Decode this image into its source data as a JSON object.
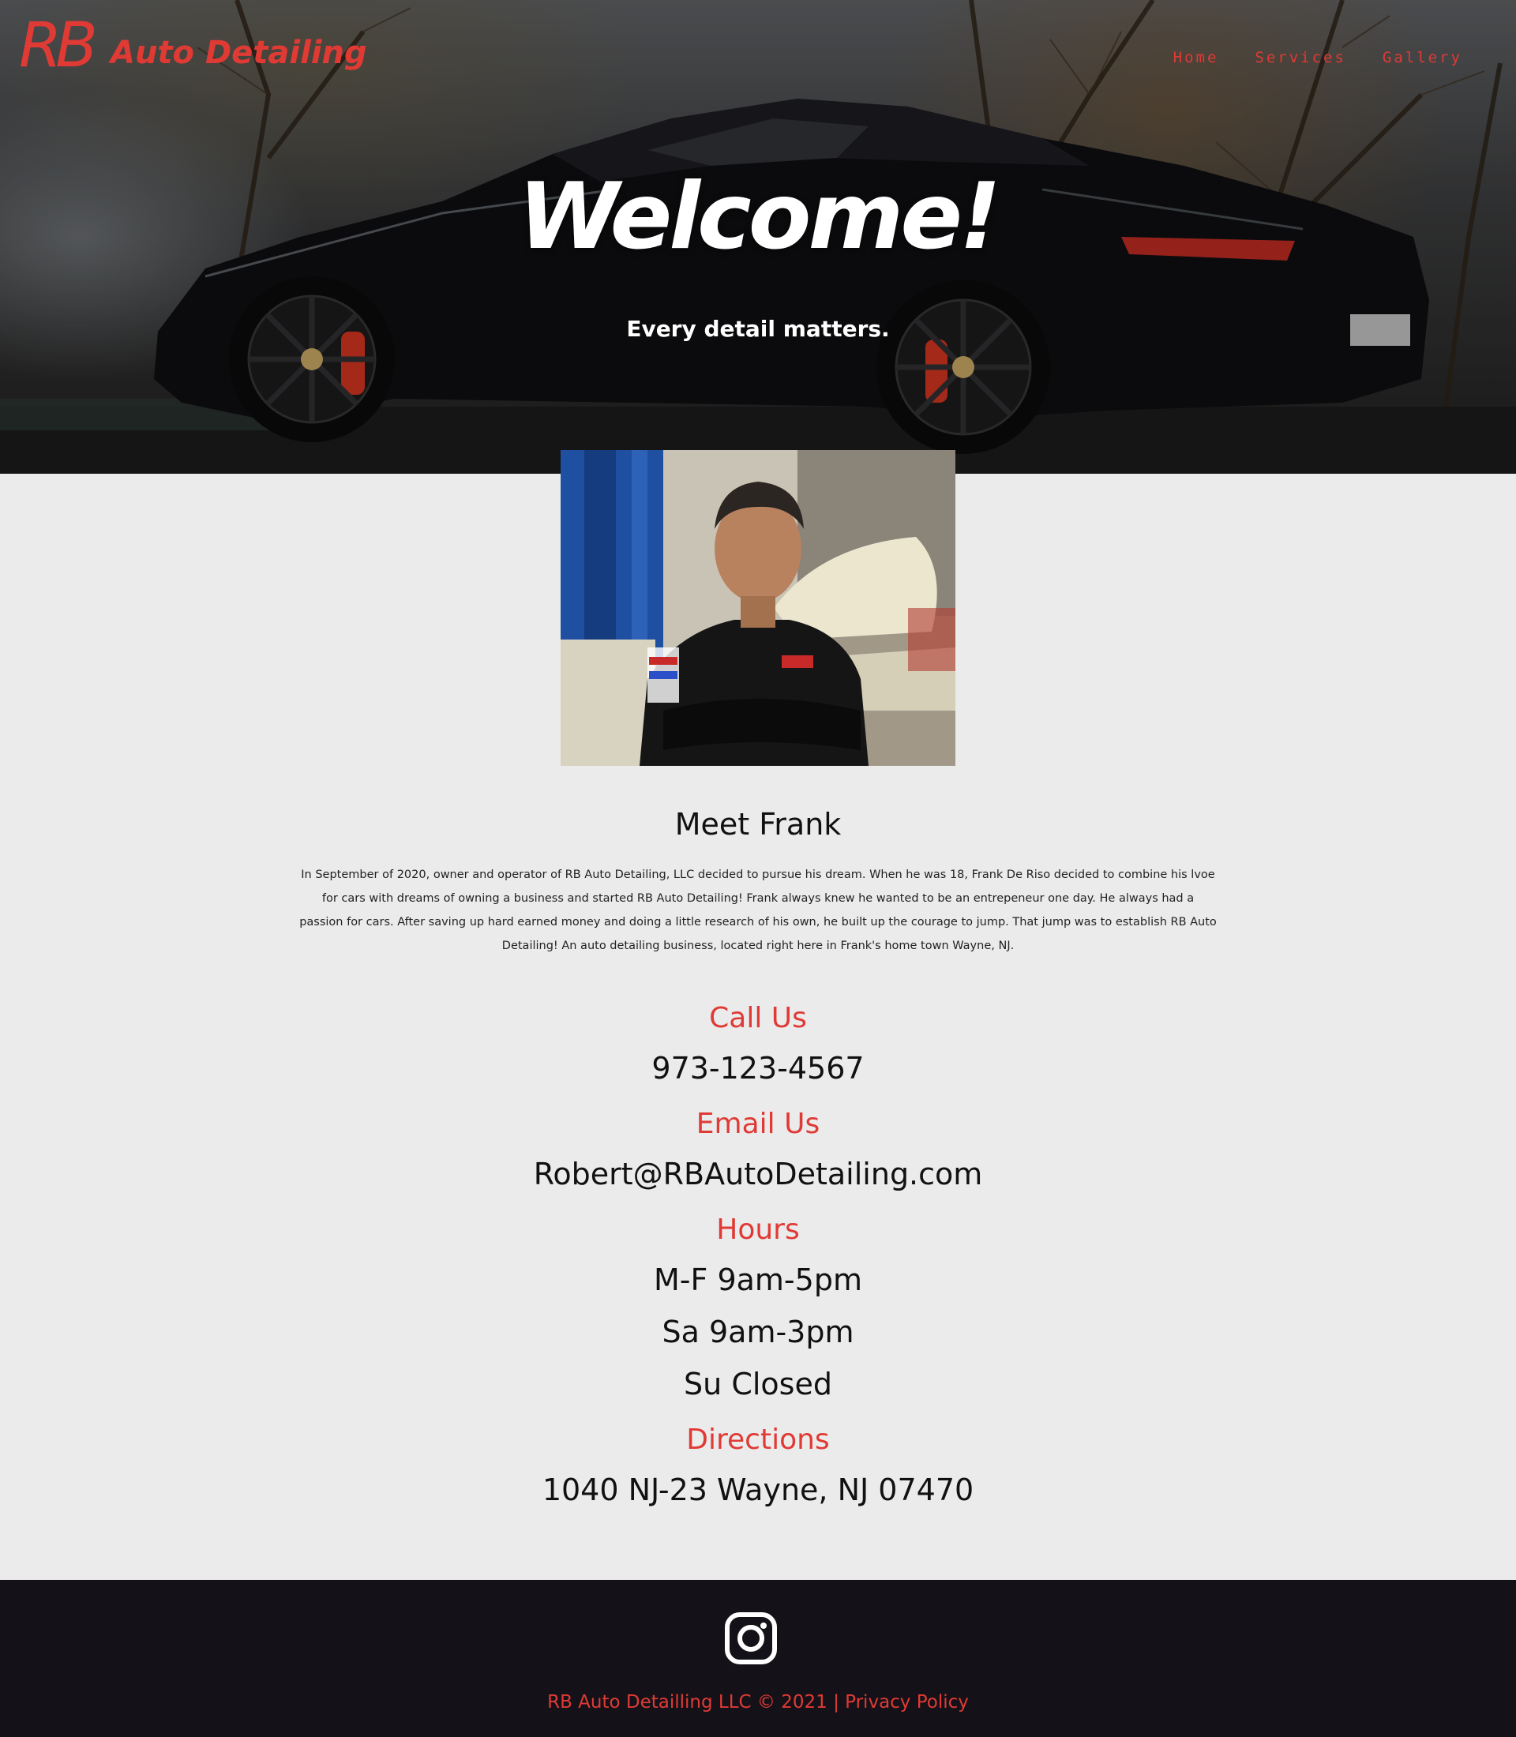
{
  "header": {
    "logo_monogram": "RB",
    "logo_text": "Auto Detailing",
    "nav": [
      {
        "label": "Home"
      },
      {
        "label": "Services"
      },
      {
        "label": "Gallery"
      }
    ]
  },
  "hero": {
    "title": "Welcome!",
    "subtitle": "Every detail matters."
  },
  "about": {
    "title": "Meet Frank",
    "text": "In September of 2020, owner and operator of RB Auto Detailing, LLC decided to pursue his dream. When he was 18, Frank De Riso decided to combine his lvoe for cars with dreams of owning a business and started RB Auto Detailing! Frank always knew he wanted to be an entrepeneur one day. He always had a passion for cars. After saving up hard earned money and doing a little research of his own, he built up the courage to jump. That jump was to establish RB Auto Detailing! An auto detailing business, located right here in Frank's home town Wayne, NJ."
  },
  "contact": {
    "call_heading": "Call Us",
    "phone": "973-123-4567",
    "email_heading": "Email Us",
    "email": "Robert@RBAutoDetailing.com",
    "hours_heading": "Hours",
    "hours": [
      "M-F 9am-5pm",
      "Sa 9am-3pm",
      "Su Closed"
    ],
    "directions_heading": "Directions",
    "address": "1040 NJ-23 Wayne, NJ 07470"
  },
  "footer": {
    "social_icon": "instagram-icon",
    "copyright": "RB Auto Detailling LLC © 2021",
    "separator": "|",
    "privacy_label": "Privacy Policy"
  },
  "colors": {
    "accent": "#e03a35",
    "page_bg": "#ebebeb",
    "footer_bg": "#141218"
  }
}
